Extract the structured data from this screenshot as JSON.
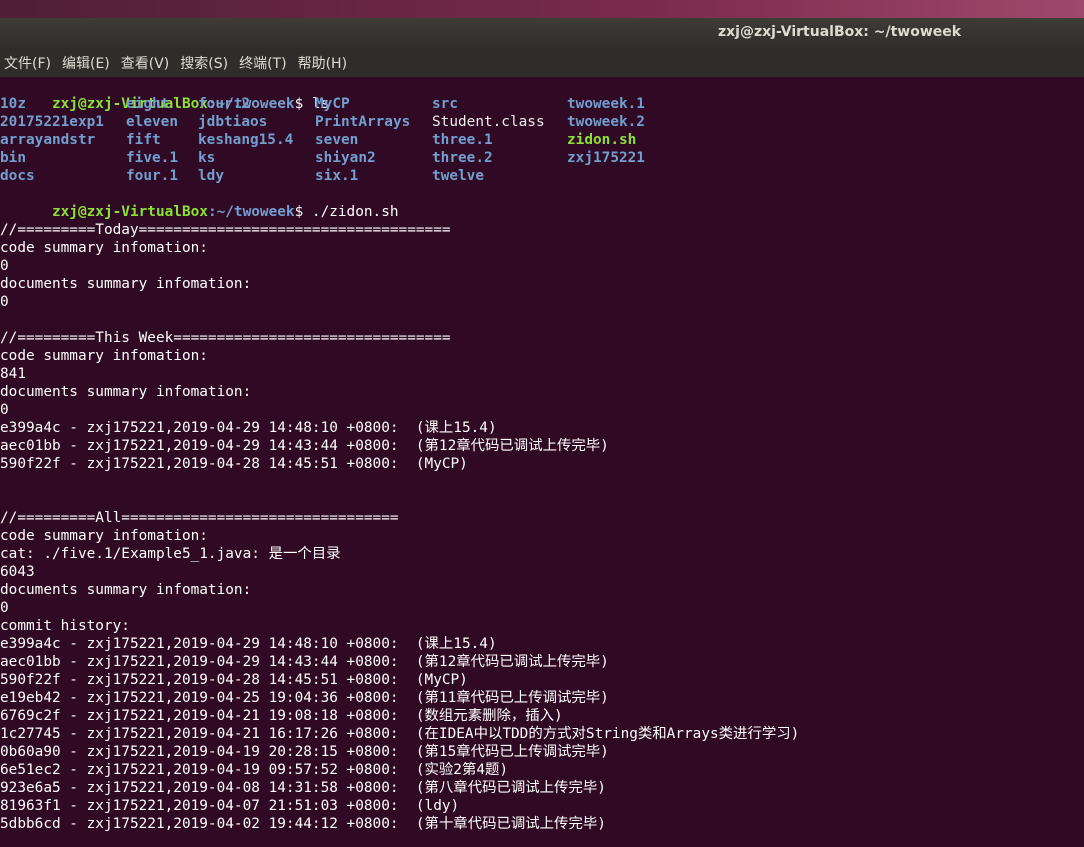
{
  "window": {
    "title": "zxj@zxj-VirtualBox: ~/twoweek"
  },
  "menu": [
    "文件(F)",
    "编辑(E)",
    "查看(V)",
    "搜索(S)",
    "终端(T)",
    "帮助(H)"
  ],
  "prompt": {
    "user_host": "zxj@zxj-VirtualBox",
    "path": ":~/twoweek",
    "symbol": "$ "
  },
  "cmd1": "ls",
  "ls_rows": [
    [
      {
        "t": "10z",
        "k": "dir"
      },
      {
        "t": "eight",
        "k": "dir"
      },
      {
        "t": "four.2",
        "k": "dir"
      },
      {
        "t": "MyCP",
        "k": "dir"
      },
      {
        "t": "src",
        "k": "dir"
      },
      {
        "t": "twoweek.1",
        "k": "dir"
      }
    ],
    [
      {
        "t": "20175221exp1",
        "k": "dir"
      },
      {
        "t": "eleven",
        "k": "dir"
      },
      {
        "t": "jdbtiaos",
        "k": "dir"
      },
      {
        "t": "PrintArrays",
        "k": "dir"
      },
      {
        "t": "Student.class",
        "k": "file"
      },
      {
        "t": "twoweek.2",
        "k": "dir"
      }
    ],
    [
      {
        "t": "arrayandstr",
        "k": "dir"
      },
      {
        "t": "fift",
        "k": "dir"
      },
      {
        "t": "keshang15.4",
        "k": "dir"
      },
      {
        "t": "seven",
        "k": "dir"
      },
      {
        "t": "three.1",
        "k": "dir"
      },
      {
        "t": "zidon.sh",
        "k": "exec"
      }
    ],
    [
      {
        "t": "bin",
        "k": "dir"
      },
      {
        "t": "five.1",
        "k": "dir"
      },
      {
        "t": "ks",
        "k": "dir"
      },
      {
        "t": "shiyan2",
        "k": "dir"
      },
      {
        "t": "three.2",
        "k": "dir"
      },
      {
        "t": "zxj175221",
        "k": "dir"
      }
    ],
    [
      {
        "t": "docs",
        "k": "dir"
      },
      {
        "t": "four.1",
        "k": "dir"
      },
      {
        "t": "ldy",
        "k": "dir"
      },
      {
        "t": "six.1",
        "k": "dir"
      },
      {
        "t": "twelve",
        "k": "dir"
      }
    ]
  ],
  "cmd2": "./zidon.sh",
  "output": [
    "",
    "//=========Today====================================",
    "code summary infomation:",
    "0",
    "documents summary infomation:",
    "0",
    "",
    "//=========This Week================================",
    "code summary infomation:",
    "841",
    "documents summary infomation:",
    "0",
    "e399a4c - zxj175221,2019-04-29 14:48:10 +0800:  (课上15.4)",
    "aec01bb - zxj175221,2019-04-29 14:43:44 +0800:  (第12章代码已调试上传完毕)",
    "590f22f - zxj175221,2019-04-28 14:45:51 +0800:  (MyCP)",
    "",
    "",
    "//=========All================================",
    "code summary infomation:",
    "cat: ./five.1/Example5_1.java: 是一个目录",
    "6043",
    "documents summary infomation:",
    "0",
    "commit history:",
    "e399a4c - zxj175221,2019-04-29 14:48:10 +0800:  (课上15.4)",
    "aec01bb - zxj175221,2019-04-29 14:43:44 +0800:  (第12章代码已调试上传完毕)",
    "590f22f - zxj175221,2019-04-28 14:45:51 +0800:  (MyCP)",
    "e19eb42 - zxj175221,2019-04-25 19:04:36 +0800:  (第11章代码已上传调试完毕)",
    "6769c2f - zxj175221,2019-04-21 19:08:18 +0800:  (数组元素删除，插入)",
    "1c27745 - zxj175221,2019-04-21 16:17:26 +0800:  (在IDEA中以TDD的方式对String类和Arrays类进行学习)",
    "0b60a90 - zxj175221,2019-04-19 20:28:15 +0800:  (第15章代码已上传调试完毕)",
    "6e51ec2 - zxj175221,2019-04-19 09:57:52 +0800:  (实验2第4题)",
    "923e6a5 - zxj175221,2019-04-08 14:31:58 +0800:  (第八章代码已调试上传完毕)",
    "81963f1 - zxj175221,2019-04-07 21:51:03 +0800:  (ldy)",
    "5dbb6cd - zxj175221,2019-04-02 19:44:12 +0800:  (第十章代码已调试上传完毕)"
  ],
  "colors": {
    "background": "#300a24",
    "prompt": "#8ae234",
    "path": "#729fcf",
    "dir": "#729fcf",
    "exec": "#8ae234"
  }
}
